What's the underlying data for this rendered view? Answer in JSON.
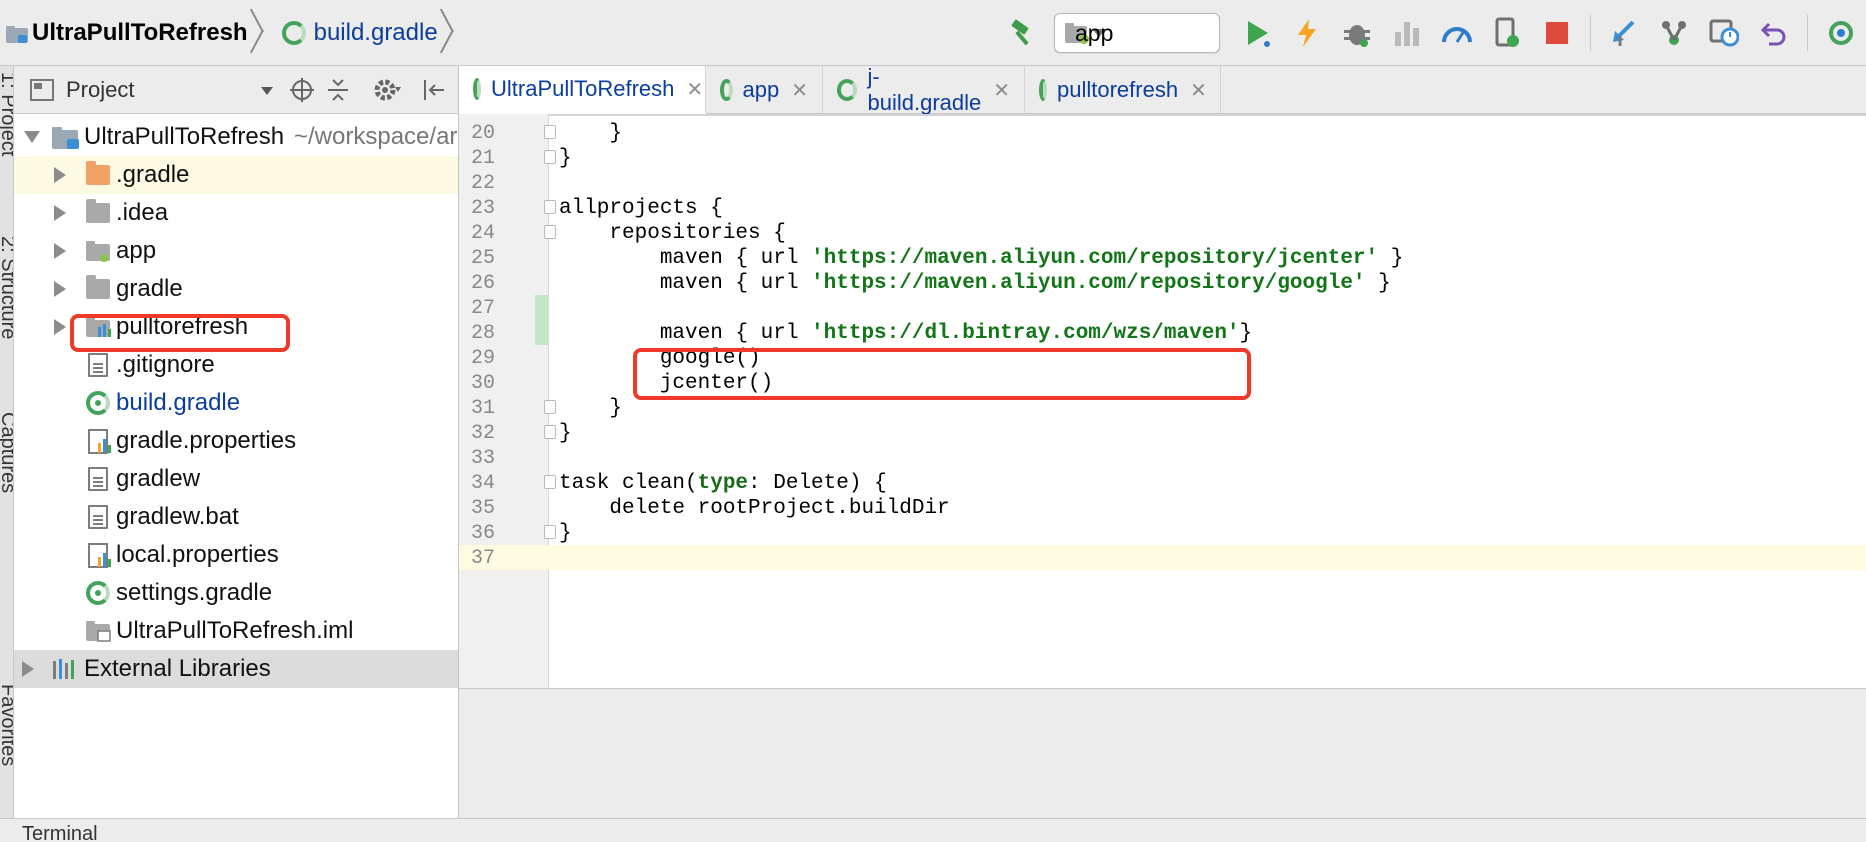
{
  "breadcrumb": {
    "project": "UltraPullToRefresh",
    "file": "build.gradle"
  },
  "toolbar": {
    "run_config": "app"
  },
  "left_strip": {
    "labels": [
      "1: Project",
      "2: Structure",
      "Captures",
      "Favorites"
    ]
  },
  "project_panel": {
    "title": "Project",
    "root": {
      "name": "UltraPullToRefresh",
      "path": "~/workspace/ar"
    },
    "items": [
      {
        "label": ".gradle",
        "icon": "folder-orange-icon"
      },
      {
        "label": ".idea",
        "icon": "folder-icon"
      },
      {
        "label": "app",
        "icon": "module-folder-icon"
      },
      {
        "label": "gradle",
        "icon": "folder-icon"
      },
      {
        "label": "pulltorefresh",
        "icon": "library-module-icon"
      },
      {
        "label": ".gitignore",
        "icon": "text-file-icon"
      },
      {
        "label": "build.gradle",
        "icon": "gradle-icon"
      },
      {
        "label": "gradle.properties",
        "icon": "properties-file-icon"
      },
      {
        "label": "gradlew",
        "icon": "text-file-icon"
      },
      {
        "label": "gradlew.bat",
        "icon": "text-file-icon"
      },
      {
        "label": "local.properties",
        "icon": "properties-file-icon"
      },
      {
        "label": "settings.gradle",
        "icon": "gradle-icon"
      },
      {
        "label": "UltraPullToRefresh.iml",
        "icon": "iml-file-icon"
      }
    ],
    "external": "External Libraries"
  },
  "tabs": [
    {
      "label": "UltraPullToRefresh"
    },
    {
      "label": "app"
    },
    {
      "label": "j-build.gradle"
    },
    {
      "label": "pulltorefresh"
    }
  ],
  "code": {
    "lines": [
      {
        "n": "20",
        "text": "    }"
      },
      {
        "n": "21",
        "text": "}"
      },
      {
        "n": "22",
        "text": ""
      },
      {
        "n": "23",
        "text": "allprojects {"
      },
      {
        "n": "24",
        "text": "    repositories {"
      },
      {
        "n": "25",
        "pre": "        maven { url ",
        "str": "'https://maven.aliyun.com/repository/jcenter'",
        "post": " }"
      },
      {
        "n": "26",
        "pre": "        maven { url ",
        "str": "'https://maven.aliyun.com/repository/google'",
        "post": " }"
      },
      {
        "n": "27",
        "text": ""
      },
      {
        "n": "28",
        "pre": "        maven { url ",
        "str": "'https://dl.bintray.com/wzs/maven'",
        "post": "}"
      },
      {
        "n": "29",
        "text": "        google()"
      },
      {
        "n": "30",
        "text": "        jcenter()"
      },
      {
        "n": "31",
        "text": "    }"
      },
      {
        "n": "32",
        "text": "}"
      },
      {
        "n": "33",
        "text": ""
      },
      {
        "n": "34",
        "pre": "task clean(",
        "kw": "type",
        "post": ": Delete) {"
      },
      {
        "n": "35",
        "text": "    delete rootProject.buildDir"
      },
      {
        "n": "36",
        "text": "}"
      },
      {
        "n": "37",
        "text": ""
      }
    ]
  },
  "bottom": {
    "terminal": "Terminal"
  },
  "colors": {
    "accent_red": "#ef3a2a",
    "gradle_green": "#44a35a",
    "link_blue": "#0b3d9c",
    "string_green": "#127617"
  }
}
